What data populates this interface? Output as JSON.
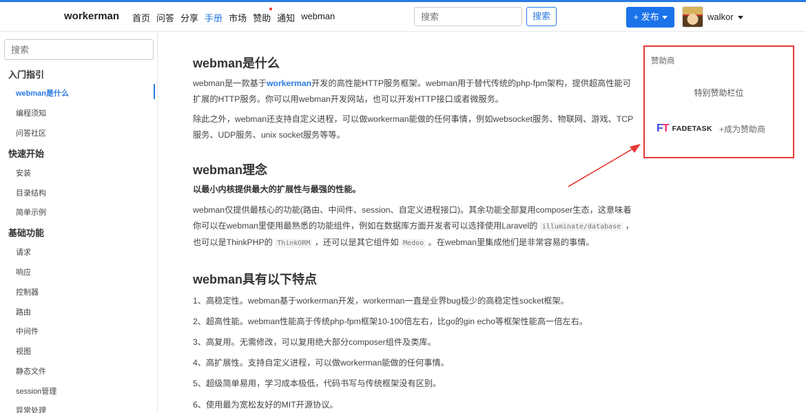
{
  "navbar": {
    "brand": "workerman",
    "links": [
      {
        "label": "首页",
        "active": false,
        "dot": false
      },
      {
        "label": "问答",
        "active": false,
        "dot": false
      },
      {
        "label": "分享",
        "active": false,
        "dot": false
      },
      {
        "label": "手册",
        "active": true,
        "dot": false
      },
      {
        "label": "市场",
        "active": false,
        "dot": false
      },
      {
        "label": "赞助",
        "active": false,
        "dot": true
      },
      {
        "label": "通知",
        "active": false,
        "dot": false
      },
      {
        "label": "webman",
        "active": false,
        "dot": false
      }
    ],
    "search_placeholder": "搜索",
    "search_button": "搜索",
    "publish_button": "+ 发布",
    "username": "walkor"
  },
  "sidebar": {
    "search_placeholder": "搜索",
    "sections": [
      {
        "title": "入门指引",
        "items": [
          "webman是什么",
          "编程须知",
          "问答社区"
        ]
      },
      {
        "title": "快速开始",
        "items": [
          "安装",
          "目录结构",
          "简单示例"
        ]
      },
      {
        "title": "基础功能",
        "items": [
          "请求",
          "响应",
          "控制器",
          "路由",
          "中间件",
          "视图",
          "静态文件",
          "session管理",
          "异常处理"
        ]
      }
    ],
    "active_item": "webman是什么"
  },
  "content": {
    "h_what": "webman是什么",
    "p1_a": "webman是一款基于",
    "p1_kw": "workerman",
    "p1_b": "开发的高性能HTTP服务框架。webman用于替代传统的php-fpm架构，提供超高性能可扩展的HTTP服务。你可以用webman开发网站，也可以开发HTTP接口或者微服务。",
    "p2": "除此之外，webman还支持自定义进程，可以做workerman能做的任何事情，例如websocket服务、物联网、游戏、TCP服务、UDP服务、unix socket服务等等。",
    "h_idea": "webman理念",
    "idea_bold": "以最小内核提供最大的扩展性与最强的性能。",
    "p3_a": "webman仅提供最核心的功能(路由、中间件、session、自定义进程接口)。其余功能全部复用composer生态，这意味着你可以在webman里使用最熟悉的功能组件，例如在数据库方面开发者可以选择使用Laravel的",
    "p3_code1": "illuminate/database",
    "p3_b": "，也可以是ThinkPHP的",
    "p3_code2": "ThinkORM",
    "p3_c": "，还可以是其它组件如",
    "p3_code3": "Medoo",
    "p3_d": "。在webman里集成他们是非常容易的事情。",
    "h_features": "webman具有以下特点",
    "features": [
      "1、高稳定性。webman基于workerman开发，workerman一直是业界bug极少的高稳定性socket框架。",
      "2、超高性能。webman性能高于传统php-fpm框架10-100倍左右，比go的gin echo等框架性能高一倍左右。",
      "3、高复用。无需修改，可以复用绝大部分composer组件及类库。",
      "4、高扩展性。支持自定义进程，可以做workerman能做的任何事情。",
      "5、超级简单易用，学习成本极低，代码书写与传统框架没有区别。",
      "6、使用最为宽松友好的MIT开源协议。"
    ]
  },
  "sponsor": {
    "title": "赞助商",
    "special": "特别赞助栏位",
    "logo_mark_a": "F",
    "logo_mark_b": "T",
    "logo_text": "FADETASK",
    "become": "+成为赞助商"
  },
  "colors": {
    "accent": "#2a7ae2",
    "annotation": "#e53935",
    "publish": "#1a73e8"
  }
}
